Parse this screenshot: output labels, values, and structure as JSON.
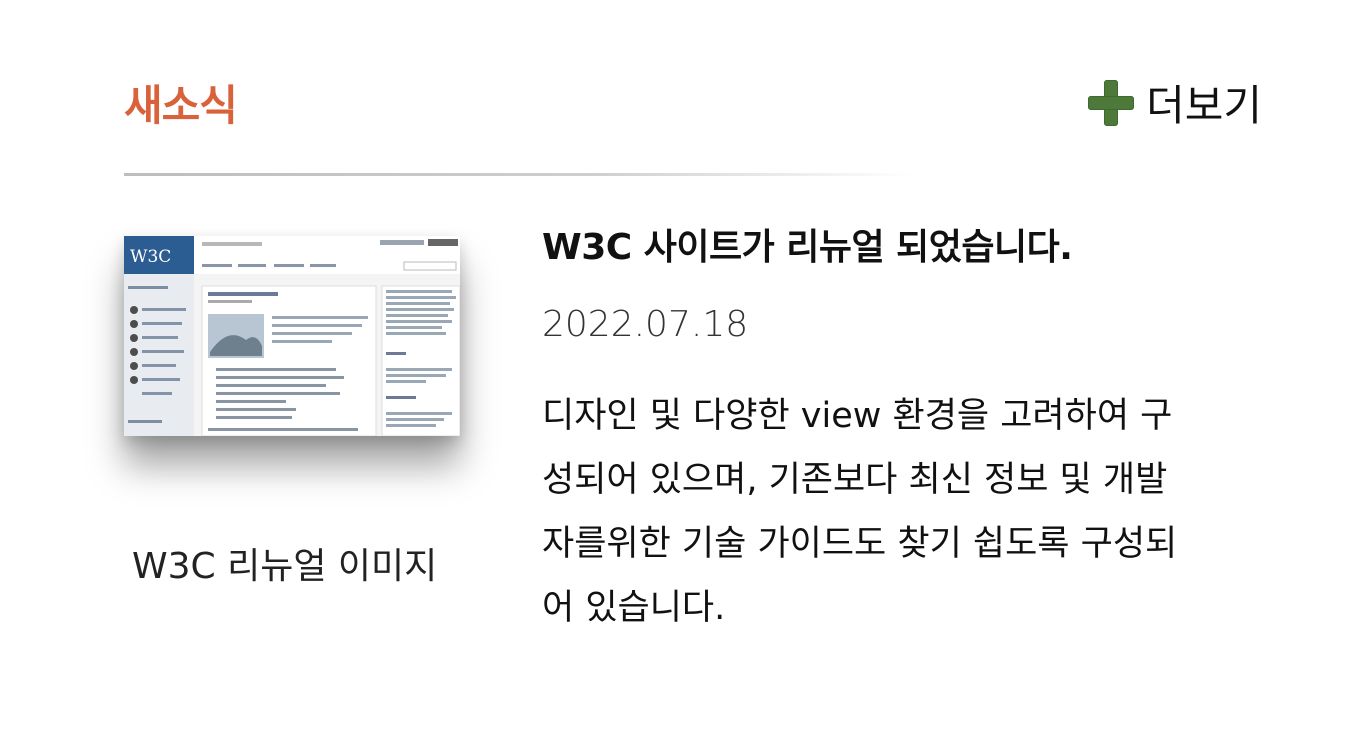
{
  "header": {
    "title": "새소식",
    "more_label": "더보기",
    "more_icon": "plus-icon",
    "title_color": "#d9623b",
    "icon_color": "#4d7a3a"
  },
  "news": {
    "thumbnail_caption": "W3C 리뉴얼 이미지",
    "thumbnail_logo": "W3C",
    "title": "W3C 사이트가 리뉴얼 되었습니다.",
    "date": "2022.07.18",
    "body_lines": [
      "디자인 및 다양한 view 환경을 고려하여 구",
      "성되어 있으며, 기존보다 최신 정보 및 개발",
      "자를위한 기술 가이드도 찾기 쉽도록 구성되",
      "어 있습니다."
    ]
  }
}
